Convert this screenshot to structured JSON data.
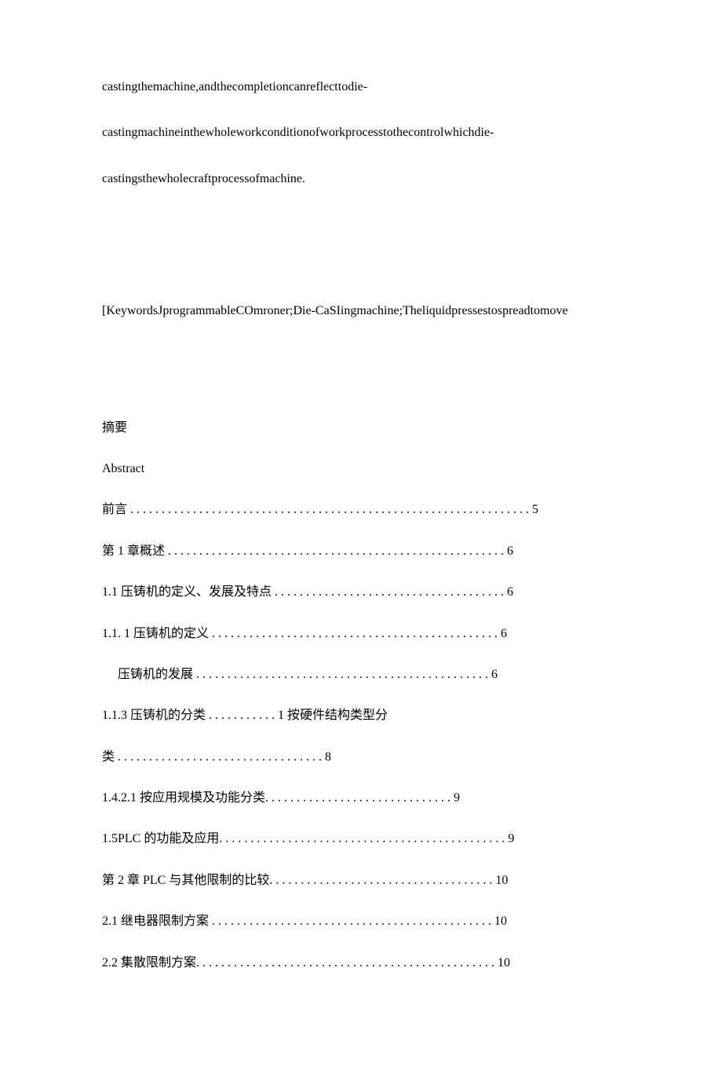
{
  "paras": {
    "p1": "castingthemachine,andthecompletioncanreflecttodie-",
    "p2": "castingmachineinthewholeworkconditionofworkprocesstothecontrolwhichdie-",
    "p3": "castingsthewholecraftprocessofmachine.",
    "p4": "[KeywordsJprogrammableCOmroner;Die-CaSIingmachine;Theliquidpressestospreadtomove"
  },
  "toc": {
    "t1": "摘要",
    "t2": "Abstract",
    "t3": "前言 . . . . . . . . . . . . . . . . . . . . . . . . . . . . . . . . . . . . . . . . . . . . . . . . . . . . . . . . . . . . . . . . 5",
    "t4": "第 1 章概述 . . . . . . . . . . . . . . . . . . . . . . . . . . . . . . . . . . . . . . . . . . . . . . . . . . . . . . 6",
    "t5": "1.1 压铸机的定义、发展及特点 . . . . . . . . . . . . . . . . . . . . . . . . . . . . . . . . . . . . . 6",
    "t6": "1.1.   1 压铸机的定义 . . . . . . . . . . . . . . . . . . . . . . . . . . . . . . . . . . . . . . . . . . . . . . 6",
    "t7": "压铸机的发展 . . . . . . . . . . . . . . . . . . . . . . . . . . . . . . . . . . . . . . . . . . . . . . . 6",
    "t8": "1.1.3 压铸机的分类 . . . . . . . . . . . 1 按硬件结构类型分",
    "t9": "类 . . . . . . . . . . . . . . . . . . . . . . . . . . . . . . . . . 8",
    "t10": "1.4.2.1 按应用规模及功能分类. . . . . . . . . . . . . . . . . . . . . . . . . . . . . . 9",
    "t11": "1.5PLC 的功能及应用. . . . . . . . . . . . . . . . . . . . . . . . . . . . . . . . . . . . . . . . . . . . . . 9",
    "t12": "第 2 章 PLC 与其他限制的比较. . . . . . . . . . . . . . . . . . . . . . . . . . . . . . . . . . . . 10",
    "t13": "2.1    继电器限制方案 . . . . . . . . . . . . . . . . . . . . . . . . . . . . . . . . . . . . . . . . . . . . . 10",
    "t14": "2.2    集散限制方案. . . . . . . . . . . . . . . . . . . . . . . . . . . . . . . . . . . . . . . . . . . . . . . . 10"
  }
}
